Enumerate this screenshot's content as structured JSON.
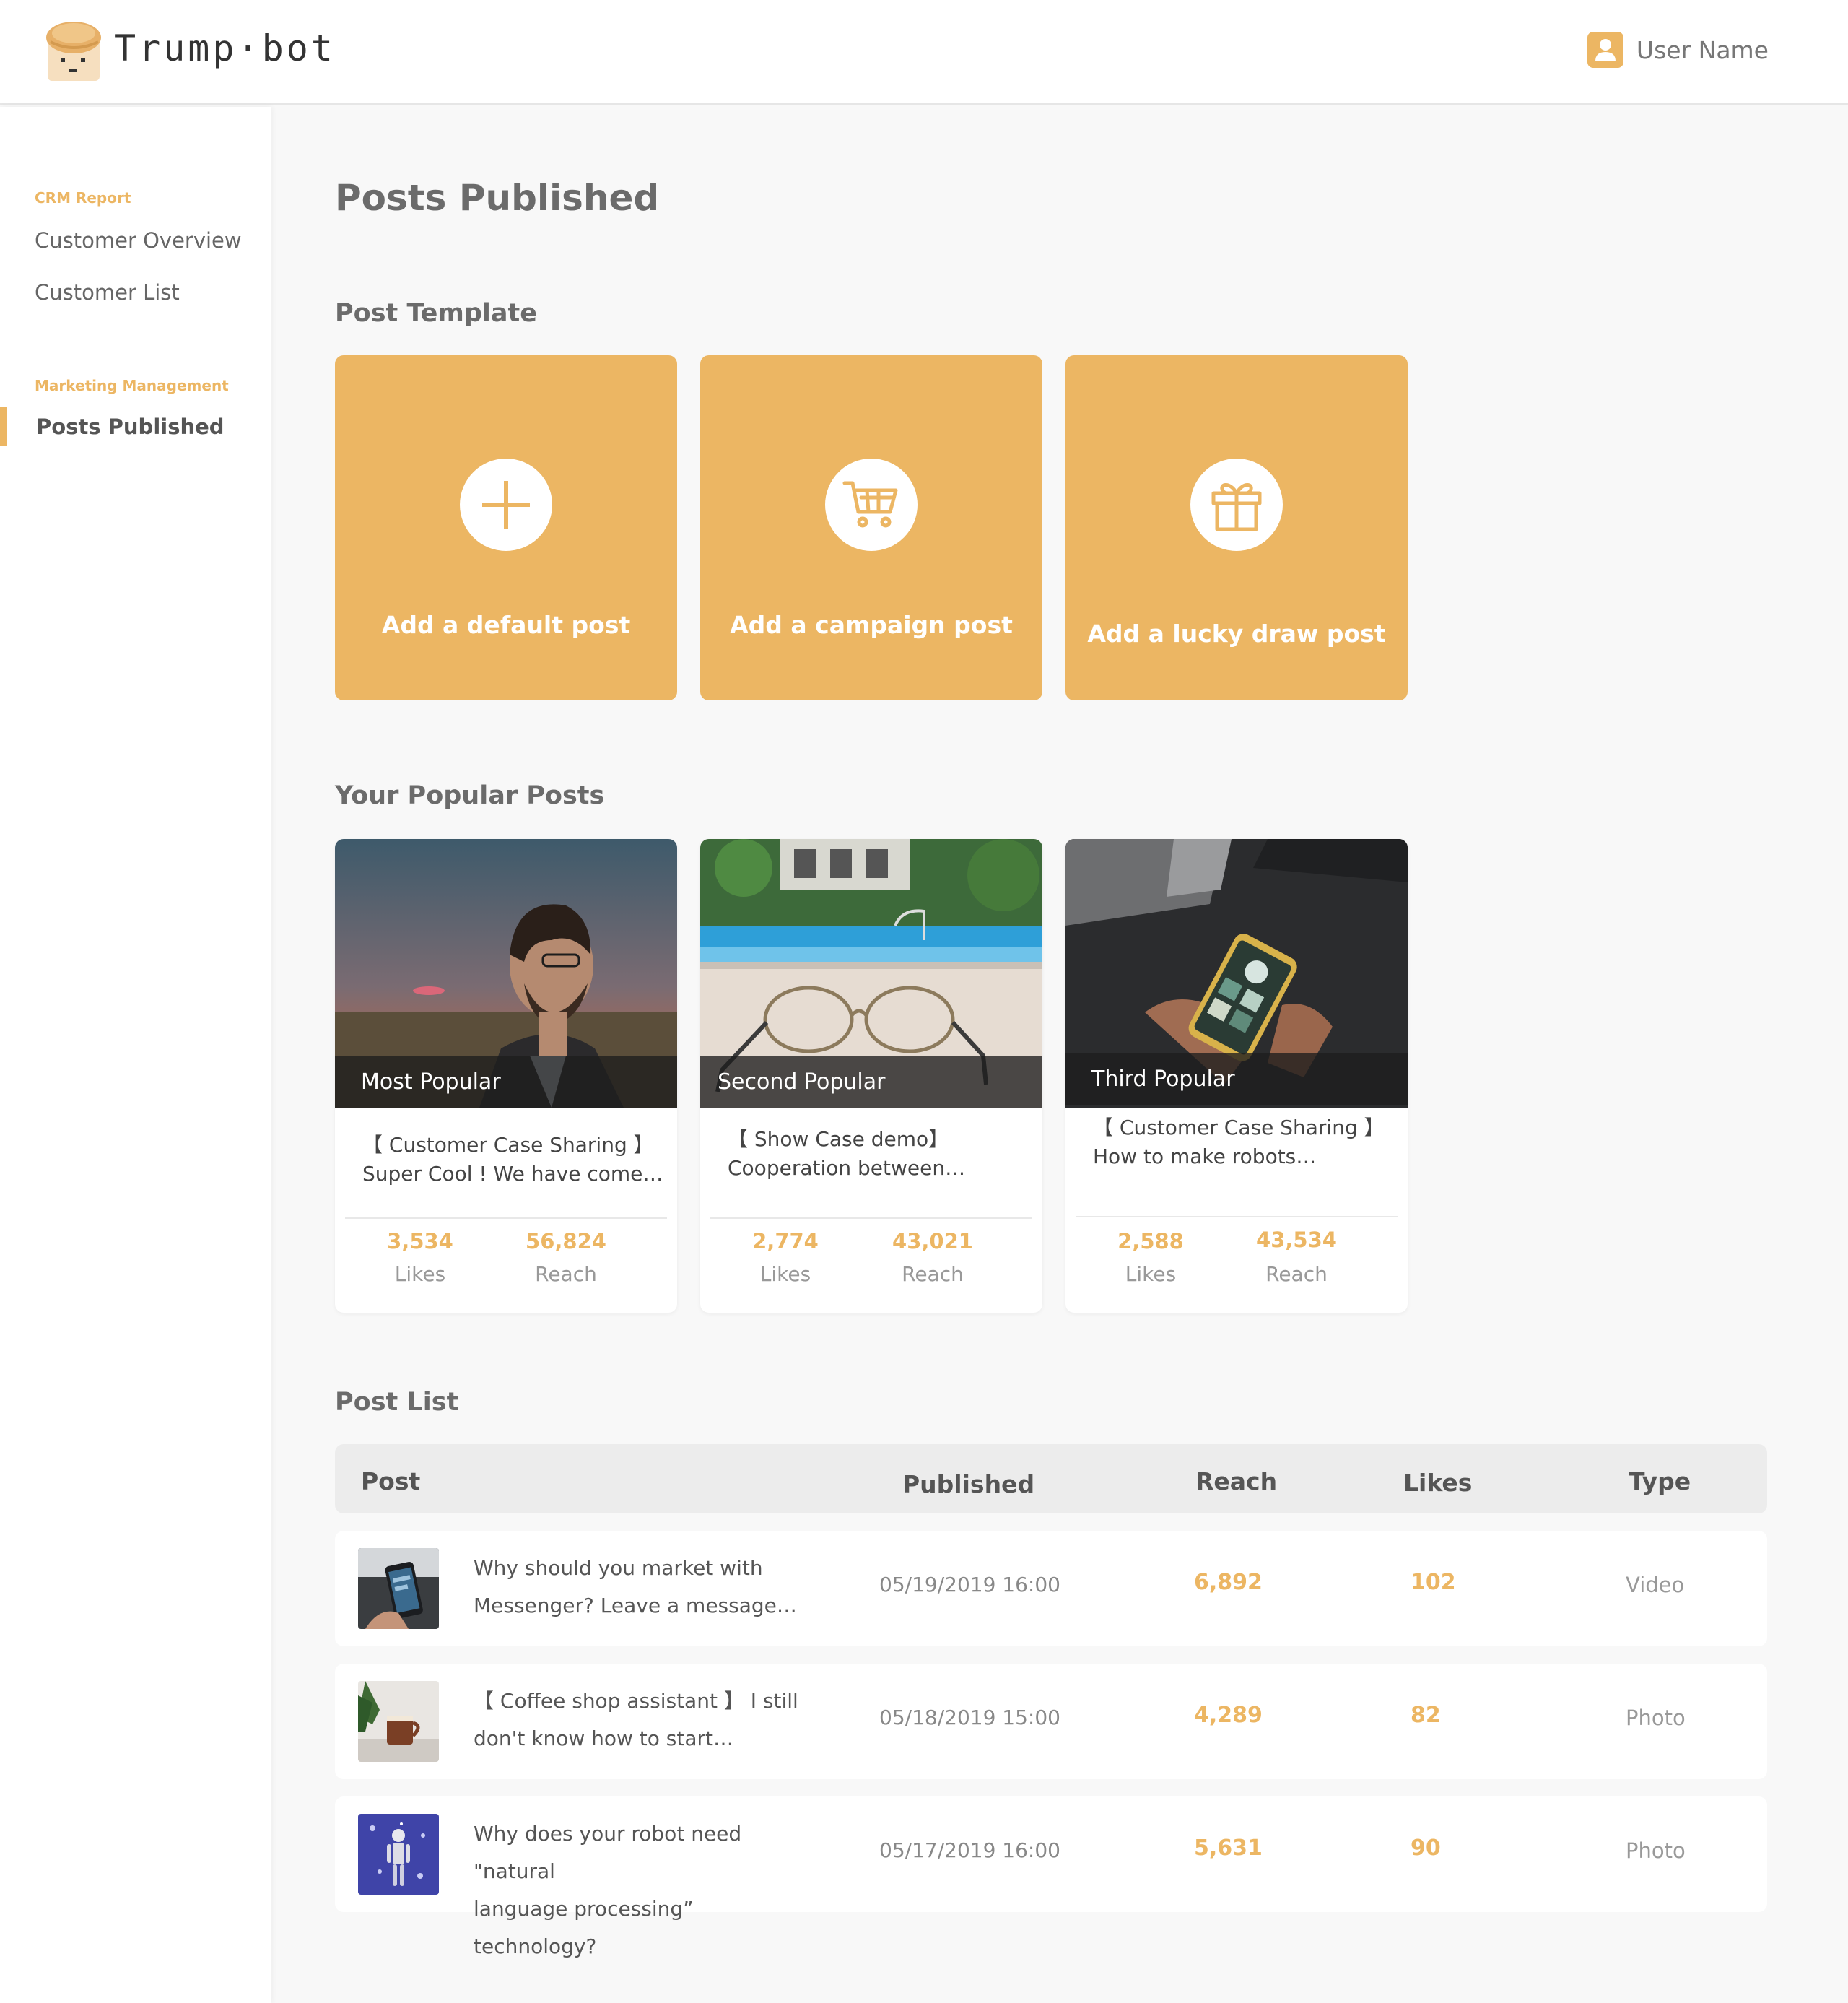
{
  "header": {
    "brand": "Trump·bot",
    "user_name": "User Name"
  },
  "sidebar": {
    "groups": [
      {
        "title": "CRM Report",
        "items": [
          "Customer Overview",
          "Customer List"
        ]
      },
      {
        "title": "Marketing Management",
        "items": [
          "Posts Published"
        ]
      }
    ],
    "active_item": "Posts Published"
  },
  "page": {
    "title": "Posts Published",
    "template_section": "Post Template",
    "popular_section": "Your Popular Posts",
    "list_section": "Post List"
  },
  "templates": [
    {
      "label": "Add a default post",
      "icon": "plus-icon"
    },
    {
      "label": "Add a campaign post",
      "icon": "cart-icon"
    },
    {
      "label": "Add a lucky draw post",
      "icon": "gift-icon"
    }
  ],
  "popular": [
    {
      "badge": "Most Popular",
      "line1": "【 Customer Case Sharing 】",
      "line2": "Super Cool ! We have come…",
      "likes": "3,534",
      "reach": "56,824",
      "likes_label": "Likes",
      "reach_label": "Reach"
    },
    {
      "badge": "Second Popular",
      "line1": "【 Show Case demo】",
      "line2": "Cooperation between…",
      "likes": "2,774",
      "reach": "43,021",
      "likes_label": "Likes",
      "reach_label": "Reach"
    },
    {
      "badge": "Third Popular",
      "line1": "【 Customer Case Sharing 】",
      "line2": "How to make robots…",
      "likes": "2,588",
      "reach": "43,534",
      "likes_label": "Likes",
      "reach_label": "Reach"
    }
  ],
  "table": {
    "columns": [
      "Post",
      "Published",
      "Reach",
      "Likes",
      "Type"
    ],
    "rows": [
      {
        "line1": "Why should you market with",
        "line2": "Messenger? Leave a message…",
        "published": "05/19/2019 16:00",
        "reach": "6,892",
        "likes": "102",
        "type": "Video"
      },
      {
        "line1": "【 Coffee shop assistant 】 I still",
        "line2": "don't know how to start…",
        "published": "05/18/2019 15:00",
        "reach": "4,289",
        "likes": "82",
        "type": "Photo"
      },
      {
        "line1": "Why does your robot need \"natural",
        "line2": "language processing” technology?",
        "published": "05/17/2019 16:00",
        "reach": "5,631",
        "likes": "90",
        "type": "Photo"
      }
    ]
  },
  "colors": {
    "accent": "#ecb663",
    "background": "#f8f8f8"
  }
}
